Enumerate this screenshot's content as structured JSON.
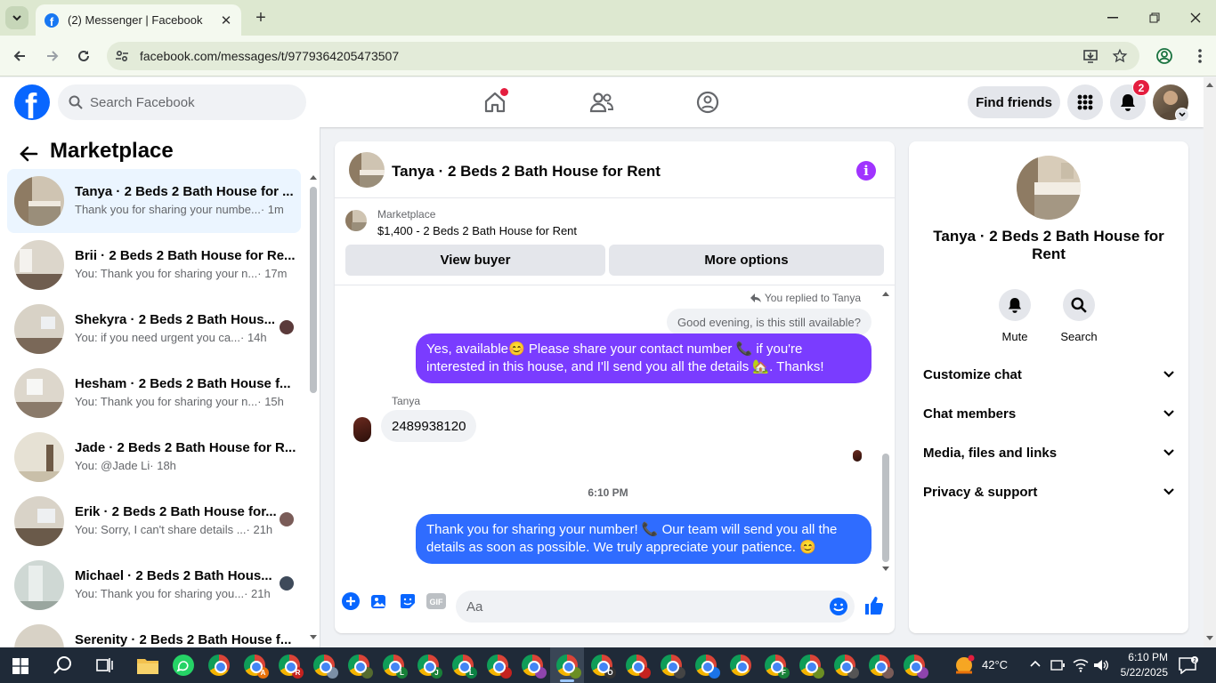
{
  "browser": {
    "tab_title": "(2) Messenger | Facebook",
    "url": "facebook.com/messages/t/9779364205473507"
  },
  "fb": {
    "search_placeholder": "Search Facebook",
    "find_friends": "Find friends",
    "notifications_count": "2",
    "brand_color": "#0866ff"
  },
  "marketplace": {
    "title": "Marketplace",
    "conversations": [
      {
        "name": "Tanya · 2 Beds 2 Bath House for ...",
        "preview": "Thank you for sharing your numbe...",
        "time": "· 1m",
        "active": true
      },
      {
        "name": "Brii · 2 Beds 2 Bath House for Re...",
        "preview": "You: Thank you for sharing your n...",
        "time": "· 17m"
      },
      {
        "name": "Shekyra · 2 Beds 2 Bath Hous...",
        "preview": "You: if you need urgent you ca...",
        "time": "· 14h"
      },
      {
        "name": "Hesham · 2 Beds 2 Bath House f...",
        "preview": "You: Thank you for sharing your n...",
        "time": "· 15h"
      },
      {
        "name": "Jade · 2 Beds 2 Bath House for R...",
        "preview": "You: @Jade Li",
        "time": "· 18h"
      },
      {
        "name": "Erik · 2 Beds 2 Bath House for...",
        "preview": "You: Sorry, I can't share details ...",
        "time": "· 21h"
      },
      {
        "name": "Michael · 2 Beds 2 Bath Hous...",
        "preview": "You: Thank you for sharing you...",
        "time": "· 21h"
      },
      {
        "name": "Serenity · 2 Beds 2 Bath House f...",
        "preview": "",
        "time": ""
      }
    ]
  },
  "chat": {
    "title": "Tanya · 2 Beds 2 Bath House for Rent",
    "listing_source": "Marketplace",
    "listing_title": "$1,400 - 2 Beds 2 Bath House for Rent",
    "view_buyer": "View buyer",
    "more_options": "More options",
    "replied_label": "You replied to Tanya",
    "quoted_text": "Good evening, is this still available?",
    "outgoing_1": "Yes, available😊 Please share your contact number 📞 if you're interested in this house, and I'll send you all the details 🏡. Thanks!",
    "sender_name": "Tanya",
    "incoming_1": "2489938120",
    "timestamp": "6:10 PM",
    "outgoing_2": "Thank you for sharing your number! 📞 Our team will send you all the details as soon as possible. We truly appreciate your patience. 😊",
    "input_placeholder": "Aa",
    "accent_purple": "#7a3cff",
    "accent_blue": "#2f6cff"
  },
  "profile": {
    "name": "Tanya · 2 Beds 2 Bath House for Rent",
    "mute": "Mute",
    "search": "Search",
    "sections": [
      "Customize chat",
      "Chat members",
      "Media, files and links",
      "Privacy & support"
    ]
  },
  "taskbar": {
    "temperature": "42°C",
    "time": "6:10 PM",
    "date": "5/22/2025"
  }
}
